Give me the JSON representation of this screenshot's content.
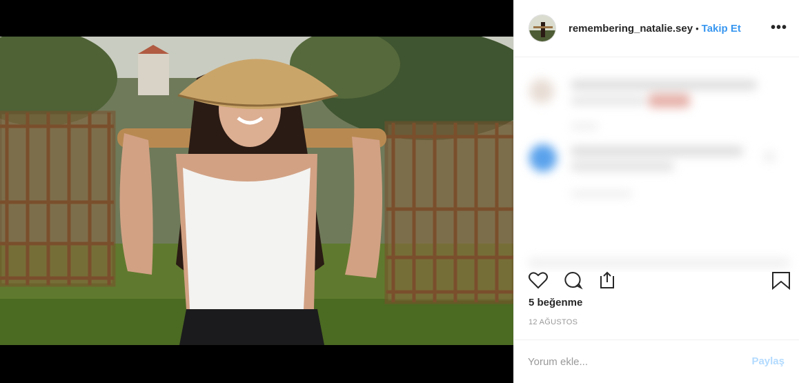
{
  "post": {
    "username": "remembering_natalie.sey",
    "separator": "•",
    "follow_label": "Takip Et",
    "more_icon": "more-options-icon",
    "likes_text": "5 beğenme",
    "date_text": "12 AĞUSTOS",
    "comment_placeholder": "Yorum ekle...",
    "share_label": "Paylaş"
  },
  "icons": {
    "like": "heart-icon",
    "comment": "comment-bubble-icon",
    "share": "share-icon",
    "save": "bookmark-icon"
  },
  "colors": {
    "accent": "#3897f0",
    "share_disabled": "#b3dbff",
    "text": "#262626",
    "muted": "#999999"
  }
}
